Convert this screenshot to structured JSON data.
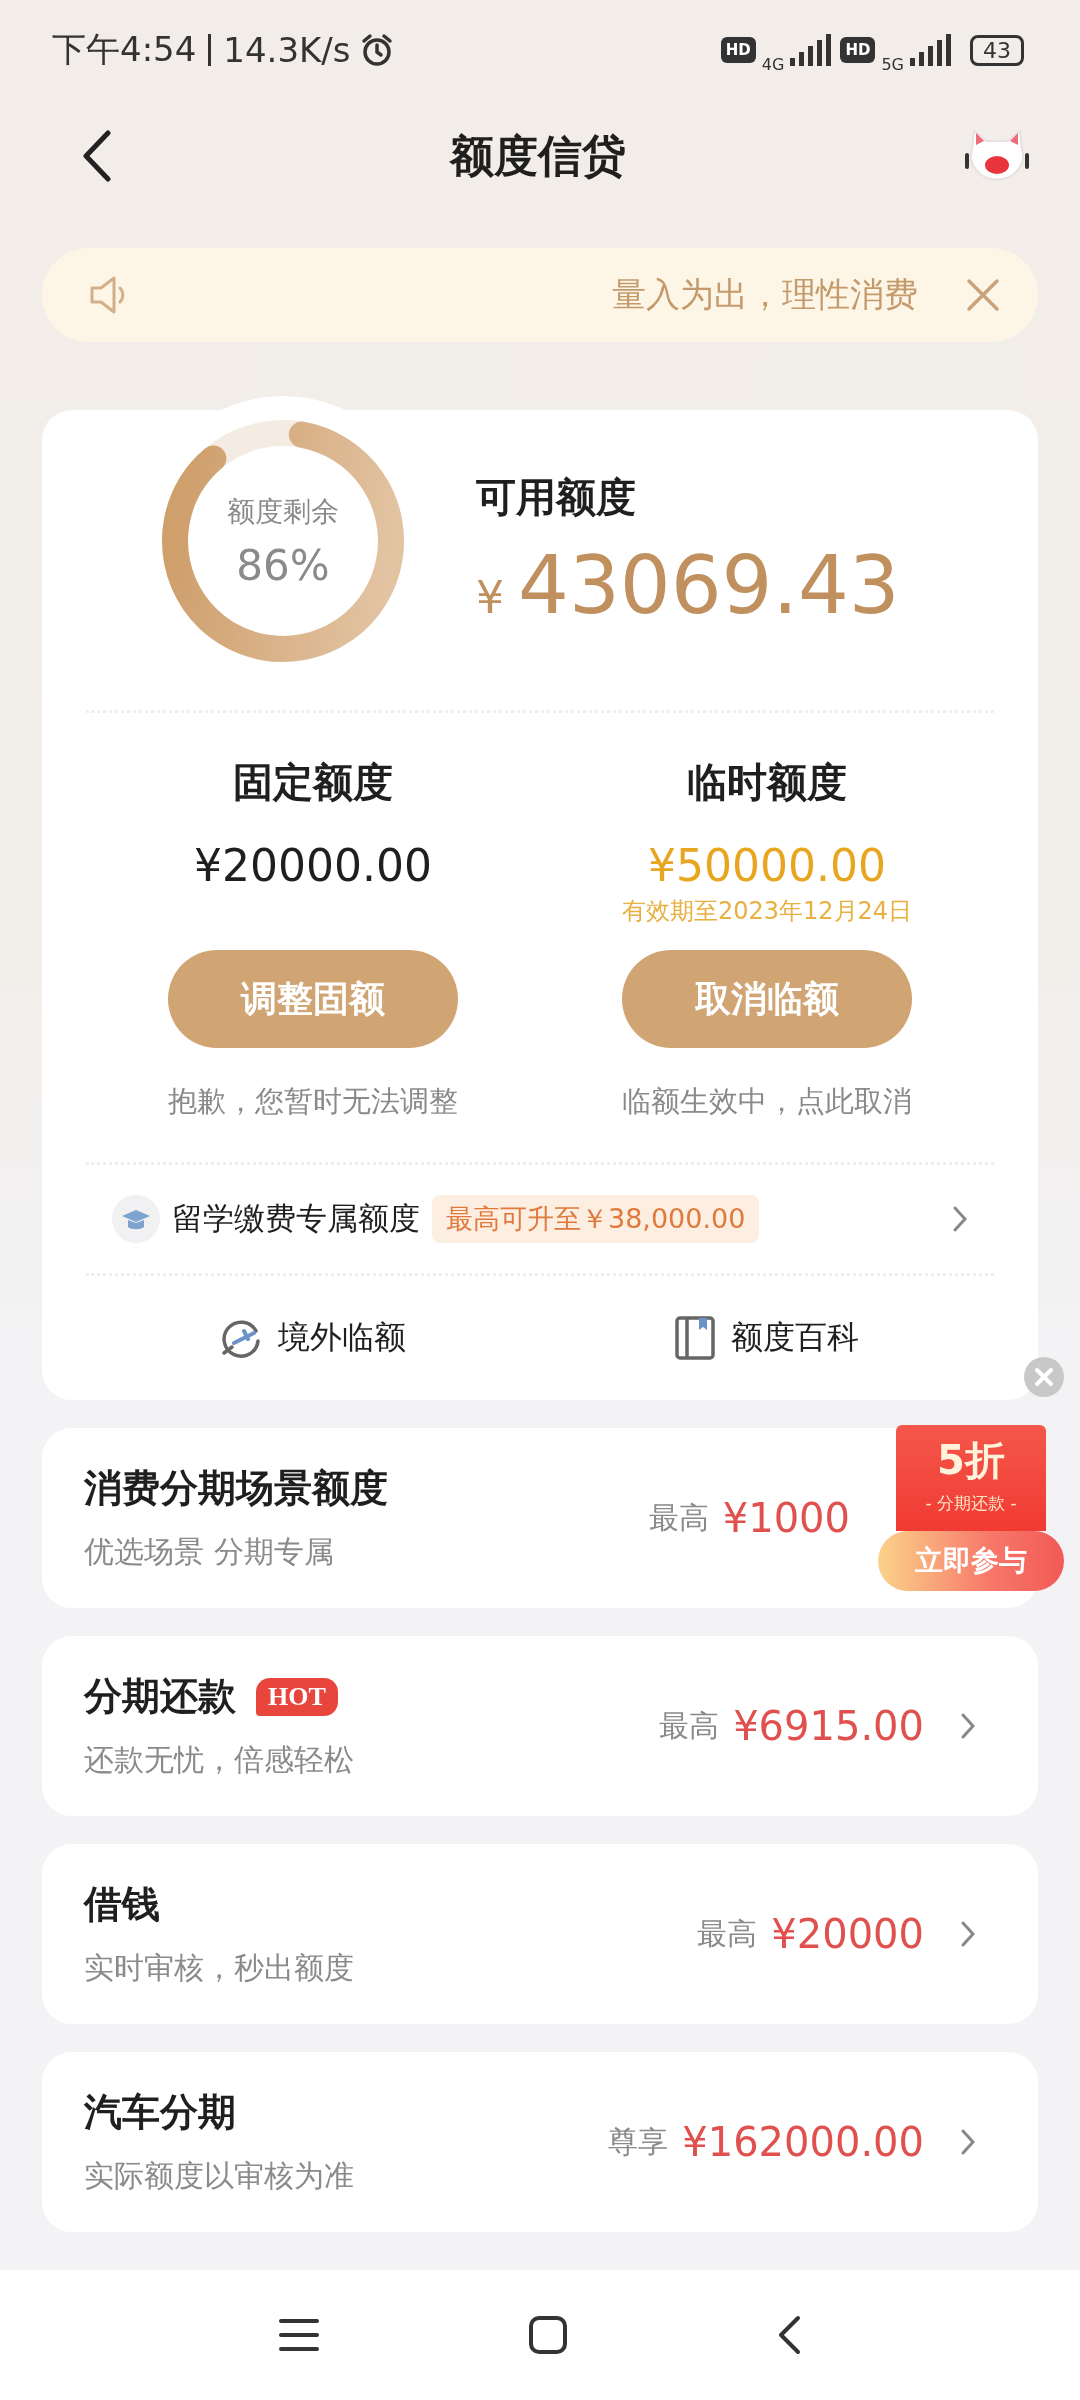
{
  "status_bar": {
    "time": "下午4:54",
    "speed": "14.3K/s",
    "hd_1": "HD",
    "network_1": "4G",
    "hd_2": "HD",
    "network_2": "5G",
    "battery": "43"
  },
  "header": {
    "title": "额度信贷"
  },
  "notice": {
    "text": "量入为出，理性消费"
  },
  "summary": {
    "ring_label": "额度剩余",
    "ring_value": "86%",
    "level": 0.86,
    "available_label": "可用额度",
    "currency": "¥",
    "available_amount": "43069.43"
  },
  "quotas": [
    {
      "kind": "fixed",
      "title": "固定额度",
      "amount": "¥20000.00",
      "button": "调整固额",
      "note": "抱歉，您暂时无法调整"
    },
    {
      "kind": "temporary",
      "title": "临时额度",
      "amount": "¥50000.00",
      "validity": "有效期至2023年12月24日",
      "button": "取消临额",
      "note": "临额生效中，点此取消"
    }
  ],
  "study": {
    "title": "留学缴费专属额度",
    "tag": "最高可升至￥38,000.00"
  },
  "links": [
    {
      "kind": "overseas",
      "label": "境外临额"
    },
    {
      "kind": "guide",
      "label": "额度百科"
    }
  ],
  "products": [
    {
      "title": "消费分期场景额度",
      "subtitle": "优选场景 分期专属",
      "prefix": "最高",
      "amount": "¥1000",
      "arrow": false
    },
    {
      "title": "分期还款",
      "badge": "HOT",
      "subtitle": "还款无忧，倍感轻松",
      "prefix": "最高",
      "amount": "¥6915.00",
      "arrow": true
    },
    {
      "title": "借钱",
      "subtitle": "实时审核，秒出额度",
      "prefix": "最高",
      "amount": "¥20000",
      "arrow": true
    },
    {
      "title": "汽车分期",
      "subtitle": "实际额度以审核为准",
      "prefix": "尊享",
      "amount": "¥162000.00",
      "arrow": true
    }
  ],
  "promo": {
    "headline": "5折",
    "subtitle": "- 分期还款 -",
    "button": "立即参与"
  }
}
